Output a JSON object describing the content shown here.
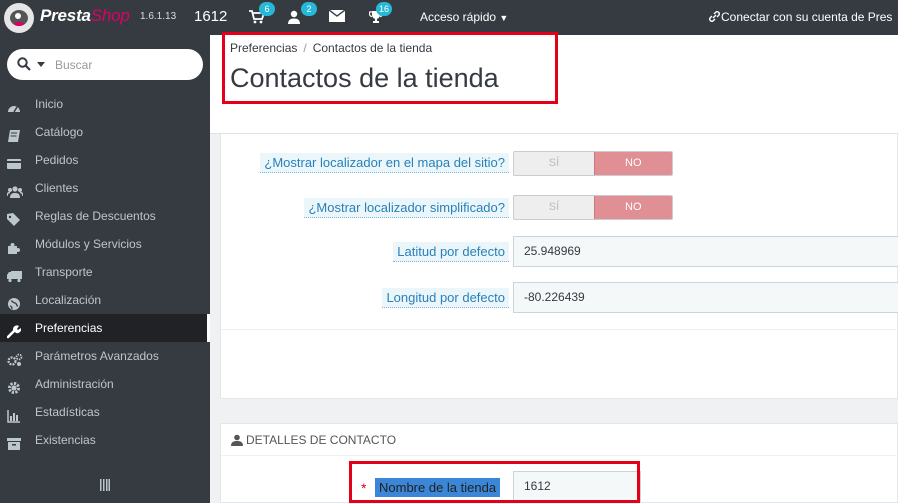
{
  "topbar": {
    "brand_presta": "Presta",
    "brand_shop": "Shop",
    "version": "1.6.1.13",
    "shop_name": "1612",
    "badges": {
      "orders": "6",
      "customers": "2",
      "new_messages": "16"
    },
    "quick_access": "Acceso rápido",
    "connect": "Conectar con su cuenta de Pres"
  },
  "sidebar": {
    "search": {
      "placeholder": "Buscar"
    },
    "items": [
      {
        "label": "Inicio",
        "icon": "dashboard-icon"
      },
      {
        "label": "Catálogo",
        "icon": "book-icon"
      },
      {
        "label": "Pedidos",
        "icon": "credit-card-icon"
      },
      {
        "label": "Clientes",
        "icon": "users-icon"
      },
      {
        "label": "Reglas de Descuentos",
        "icon": "tags-icon"
      },
      {
        "label": "Módulos y Servicios",
        "icon": "puzzle-icon"
      },
      {
        "label": "Transporte",
        "icon": "truck-icon"
      },
      {
        "label": "Localización",
        "icon": "globe-icon"
      },
      {
        "label": "Preferencias",
        "icon": "wrench-icon",
        "active": true
      },
      {
        "label": "Parámetros Avanzados",
        "icon": "cogs-icon"
      },
      {
        "label": "Administración",
        "icon": "cog-icon"
      },
      {
        "label": "Estadísticas",
        "icon": "bar-chart-icon"
      },
      {
        "label": "Existencias",
        "icon": "archive-icon"
      }
    ]
  },
  "header": {
    "breadcrumb": [
      "Preferencias",
      "Contactos de la tienda"
    ],
    "breadcrumb_separator": "/",
    "title": "Contactos de la tienda"
  },
  "form": {
    "fields": [
      {
        "label": "¿Mostrar localizador en el mapa del sitio?",
        "type": "toggle",
        "yes": "SÍ",
        "no": "NO",
        "value": "NO"
      },
      {
        "label": "¿Mostrar localizador simplificado?",
        "type": "toggle",
        "yes": "SÍ",
        "no": "NO",
        "value": "NO"
      },
      {
        "label": "Latitud por defecto",
        "type": "text",
        "value": "25.948969"
      },
      {
        "label": "Longitud por defecto",
        "type": "text",
        "value": "-80.226439"
      }
    ]
  },
  "contact": {
    "heading": "DETALLES DE CONTACTO",
    "required_mark": "*",
    "name_label": "Nombre de la tienda",
    "name_value": "1612"
  },
  "colors": {
    "sidebar_bg": "#363a41",
    "accent": "#25b9d7",
    "brand_pink": "#df0067",
    "toggle_no": "#e08f95",
    "highlight_box": "#e3001b",
    "selection_blue": "#3b86d6"
  }
}
